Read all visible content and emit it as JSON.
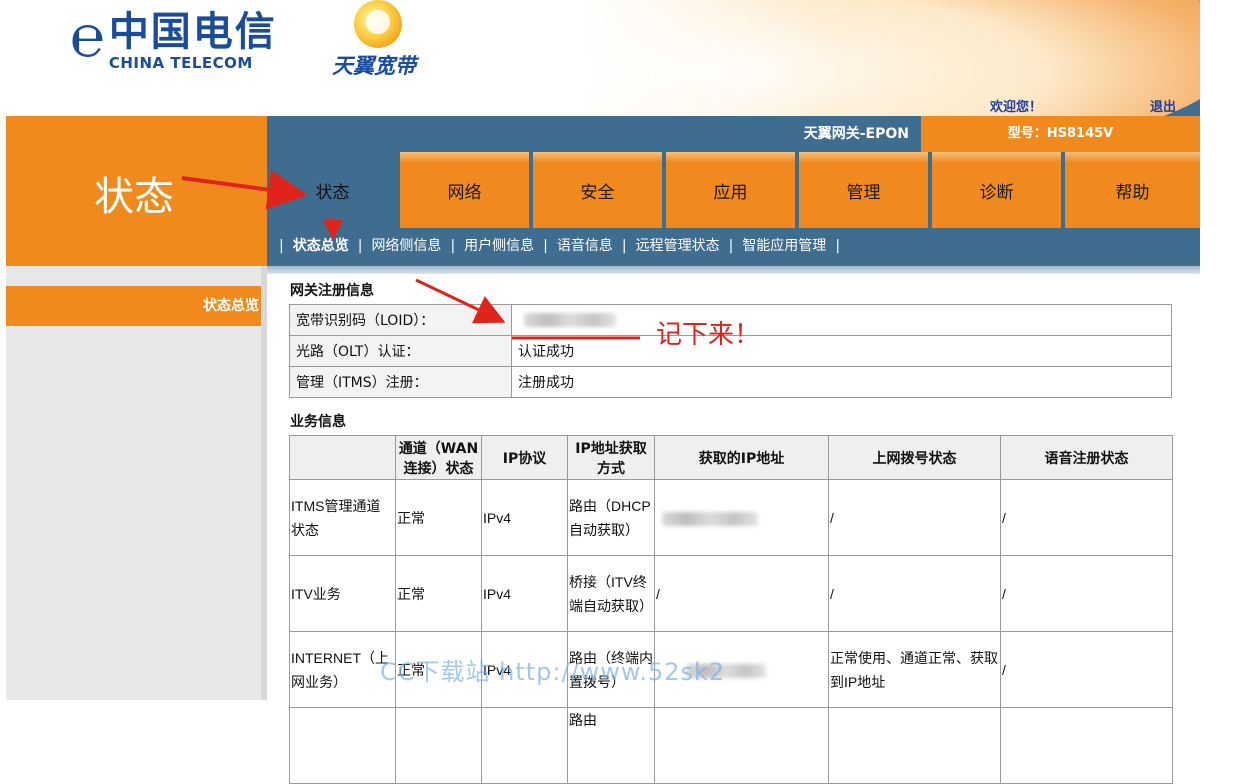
{
  "header": {
    "brand_cn": "中国电信",
    "brand_en": "CHINA TELECOM",
    "sub_brand": "天翼宽带",
    "welcome": "欢迎您！",
    "logout": "退出"
  },
  "topbar": {
    "gateway": "天翼网关-EPON",
    "model_label": "型号：HS8145V"
  },
  "left_panel": {
    "title": "状态",
    "menu_item": "状态总览"
  },
  "tabs": [
    "状态",
    "网络",
    "安全",
    "应用",
    "管理",
    "诊断",
    "帮助"
  ],
  "active_tab": "状态",
  "subnav": [
    "状态总览",
    "网络侧信息",
    "用户侧信息",
    "语音信息",
    "远程管理状态",
    "智能应用管理"
  ],
  "registration": {
    "title": "网关注册信息",
    "rows": [
      {
        "label": "宽带识别码（LOID）：",
        "value": ""
      },
      {
        "label": "光路（OLT）认证：",
        "value": "认证成功"
      },
      {
        "label": "管理（ITMS）注册：",
        "value": "注册成功"
      }
    ]
  },
  "annotation": "记下来！",
  "business": {
    "title": "业务信息",
    "headers": [
      "",
      "通道（WAN连接）状态",
      "IP协议",
      "IP地址获取方式",
      "获取的IP地址",
      "上网拨号状态",
      "语音注册状态"
    ],
    "rows": [
      {
        "name": "ITMS管理通道状态",
        "status": "正常",
        "protocol": "IPv4",
        "method": "路由（DHCP自动获取）",
        "ip": "",
        "dial": "/",
        "voice": "/"
      },
      {
        "name": "ITV业务",
        "status": "正常",
        "protocol": "IPv4",
        "method": "桥接（ITV终端自动获取）",
        "ip": "/",
        "dial": "/",
        "voice": "/"
      },
      {
        "name": "INTERNET（上网业务）",
        "status": "正常",
        "protocol": "IPv4",
        "method": "路由（终端内置拨号）",
        "ip": "",
        "dial": "正常使用、通道正常、获取到IP地址",
        "voice": "/"
      },
      {
        "name": "",
        "status": "",
        "protocol": "",
        "method": "路由",
        "ip": "",
        "dial": "",
        "voice": ""
      }
    ]
  },
  "watermark": "CC下载站 http://www.52sk2"
}
